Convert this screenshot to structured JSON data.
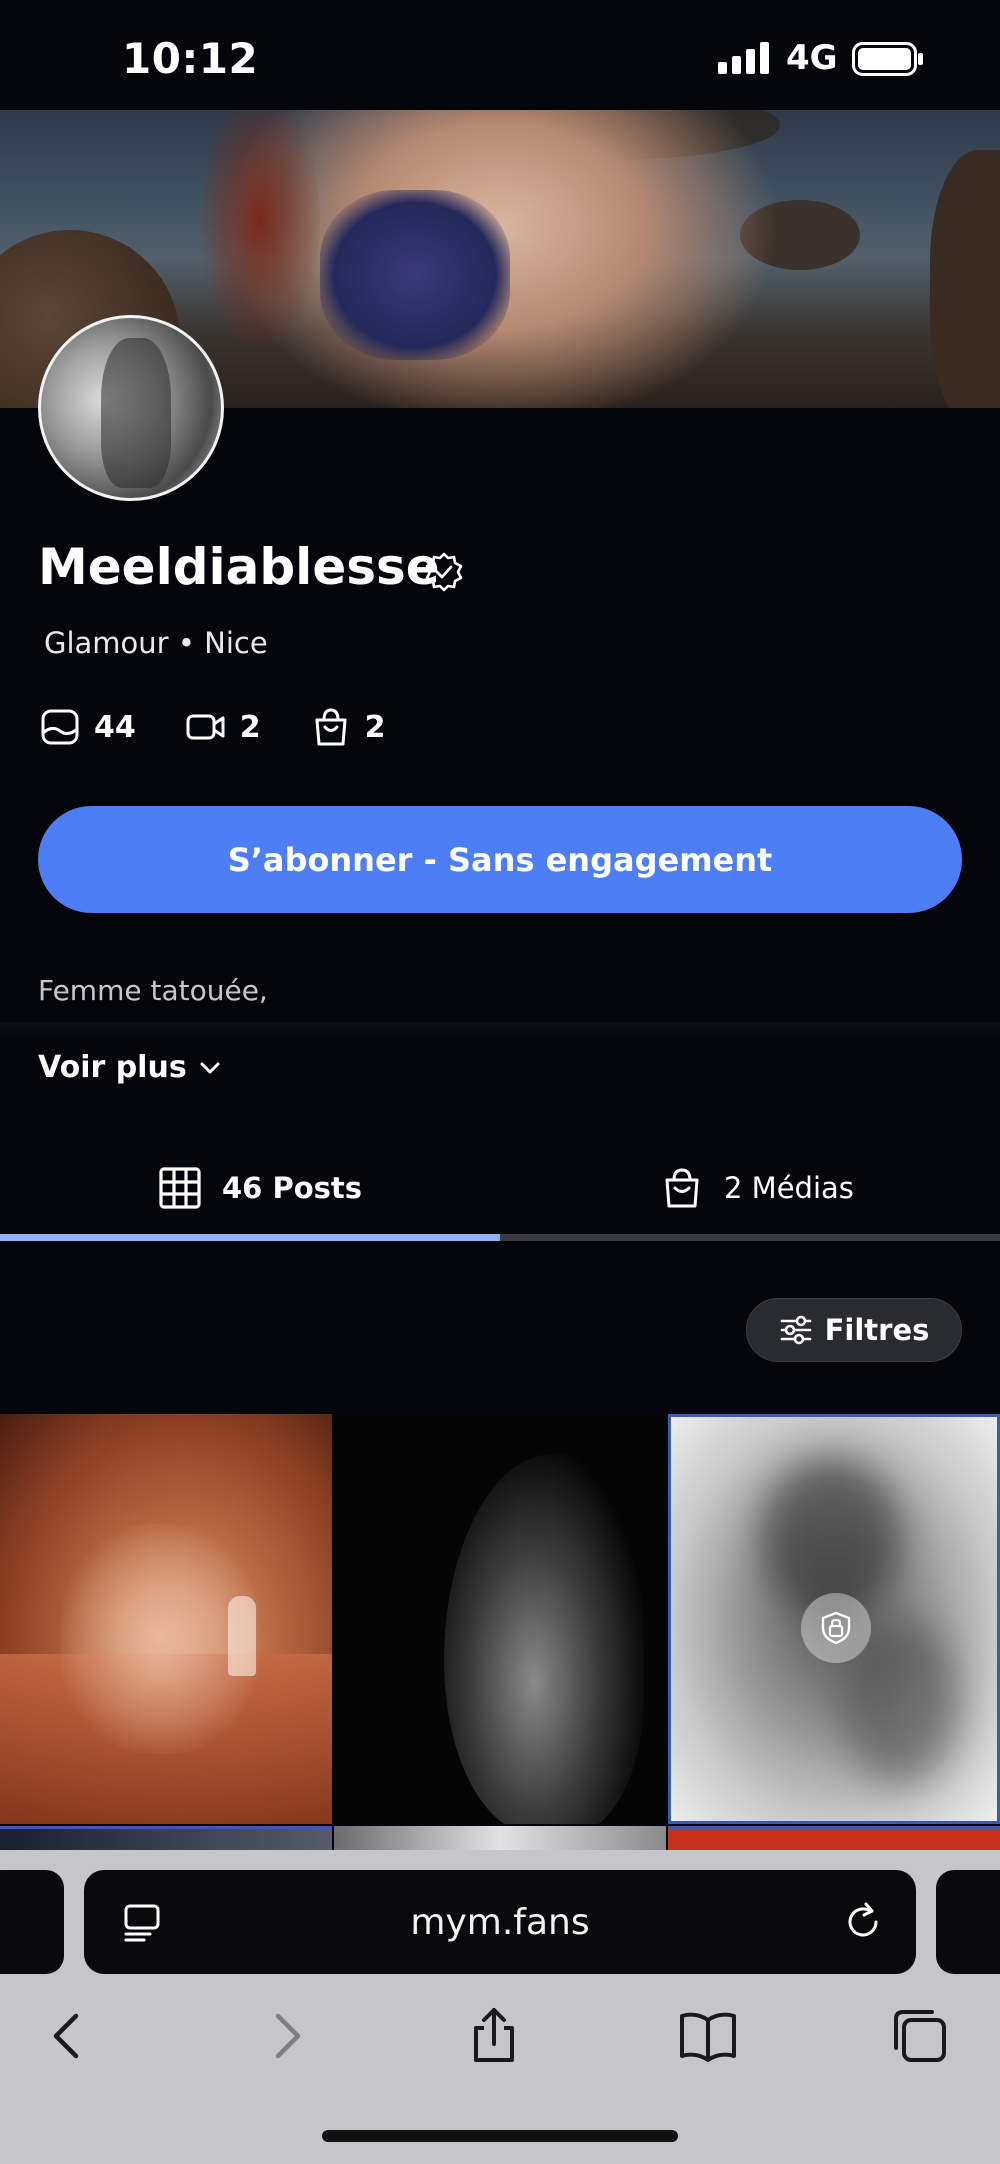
{
  "status_bar": {
    "time": "10:12",
    "network": "4G"
  },
  "profile": {
    "name": "Meeldiablesse",
    "subtitle": "Glamour • Nice",
    "stats": [
      {
        "icon": "photo-icon",
        "value": "44"
      },
      {
        "icon": "video-icon",
        "value": "2"
      },
      {
        "icon": "bag-icon",
        "value": "2"
      }
    ],
    "subscribe_label": "S’abonner - Sans engagement",
    "bio": "Femme tatouée,",
    "see_more_label": "Voir plus"
  },
  "tabs": {
    "posts_label": "46 Posts",
    "medias_label": "2 Médias",
    "active": "posts"
  },
  "filters_label": "Filtres",
  "browser": {
    "url": "mym.fans"
  },
  "colors": {
    "background": "#05060c",
    "accent": "#4d7ef5",
    "tab_indicator": "#8fb1ef",
    "toolbar": "#c6c6ca"
  }
}
